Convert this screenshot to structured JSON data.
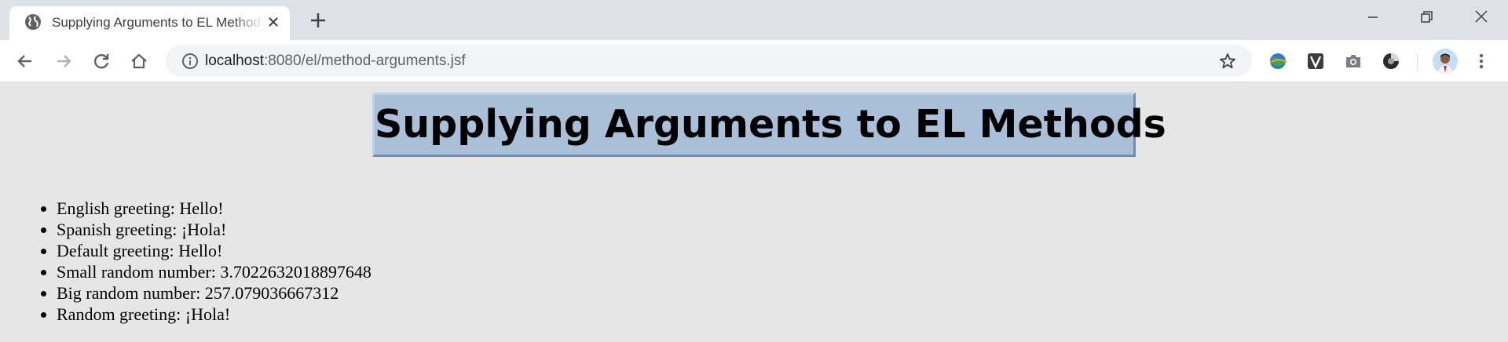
{
  "browser": {
    "tab": {
      "title": "Supplying Arguments to EL Methods"
    },
    "address_bar": {
      "host": "localhost",
      "path": ":8080/el/method-arguments.jsf"
    }
  },
  "page": {
    "heading": "Supplying Arguments to EL Methods",
    "items": [
      "English greeting: Hello!",
      "Spanish greeting: ¡Hola!",
      "Default greeting: Hello!",
      "Small random number: 3.7022632018897648",
      "Big random number: 257.079036667312",
      "Random greeting: ¡Hola!"
    ]
  },
  "icons": {
    "tab": [
      "globe-icon",
      "close-icon",
      "plus-icon"
    ],
    "window": [
      "minimize-icon",
      "restore-icon",
      "close-window-icon"
    ],
    "toolbar": [
      "back-arrow-icon",
      "forward-arrow-icon",
      "reload-icon",
      "home-icon",
      "info-icon",
      "star-icon",
      "menu-dots-icon"
    ],
    "extensions": [
      "earth-extension-icon",
      "v-extension-icon",
      "camera-extension-icon",
      "circle-extension-icon"
    ]
  },
  "colors": {
    "tabstrip": "#dee1e6",
    "page_background": "#e6e6e6",
    "heading_box": "#aac0d8"
  }
}
